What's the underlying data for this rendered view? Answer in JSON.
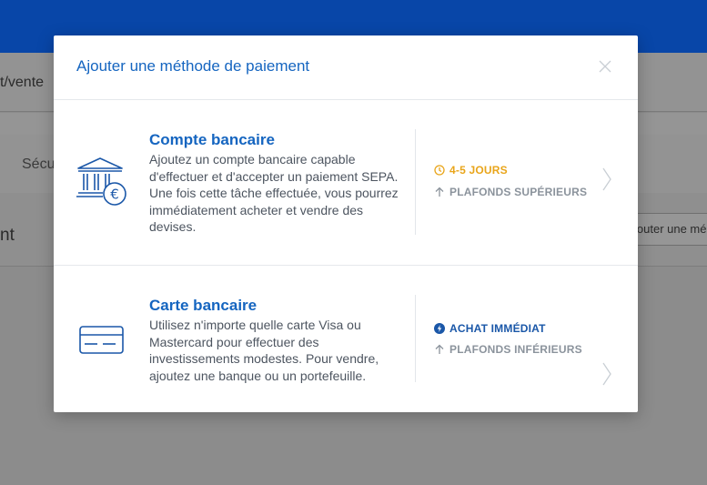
{
  "background": {
    "crumb_text": "t/vente",
    "tab_text": "Sécu",
    "row_text": "nt",
    "button_label": "jouter une mé"
  },
  "modal": {
    "title": "Ajouter une méthode de paiement",
    "close_icon": "close-icon",
    "options": [
      {
        "title": "Compte bancaire",
        "description": "Ajoutez un compte bancaire capable d'effectuer et d'accepter un paiement SEPA. Une fois cette tâche effectuée, vous pourrez immédiatement acheter et vendre des devises.",
        "icon": "bank-euro-icon",
        "meta_primary": "4-5 JOURS",
        "meta_primary_icon": "clock-icon",
        "meta_secondary": "PLAFONDS SUPÉRIEURS",
        "meta_secondary_icon": "arrow-up-icon"
      },
      {
        "title": "Carte bancaire",
        "description": "Utilisez n'importe quelle carte Visa ou Mastercard pour effectuer des investissements modestes. Pour vendre, ajoutez une banque ou un portefeuille.",
        "icon": "credit-card-icon",
        "meta_primary": "ACHAT IMMÉDIAT",
        "meta_primary_icon": "lightning-icon",
        "meta_secondary": "PLAFONDS INFÉRIEURS",
        "meta_secondary_icon": "arrow-up-icon"
      }
    ]
  },
  "colors": {
    "brand_blue": "#1565c0",
    "top_bar": "#0846a8",
    "orange": "#e9a51a"
  }
}
